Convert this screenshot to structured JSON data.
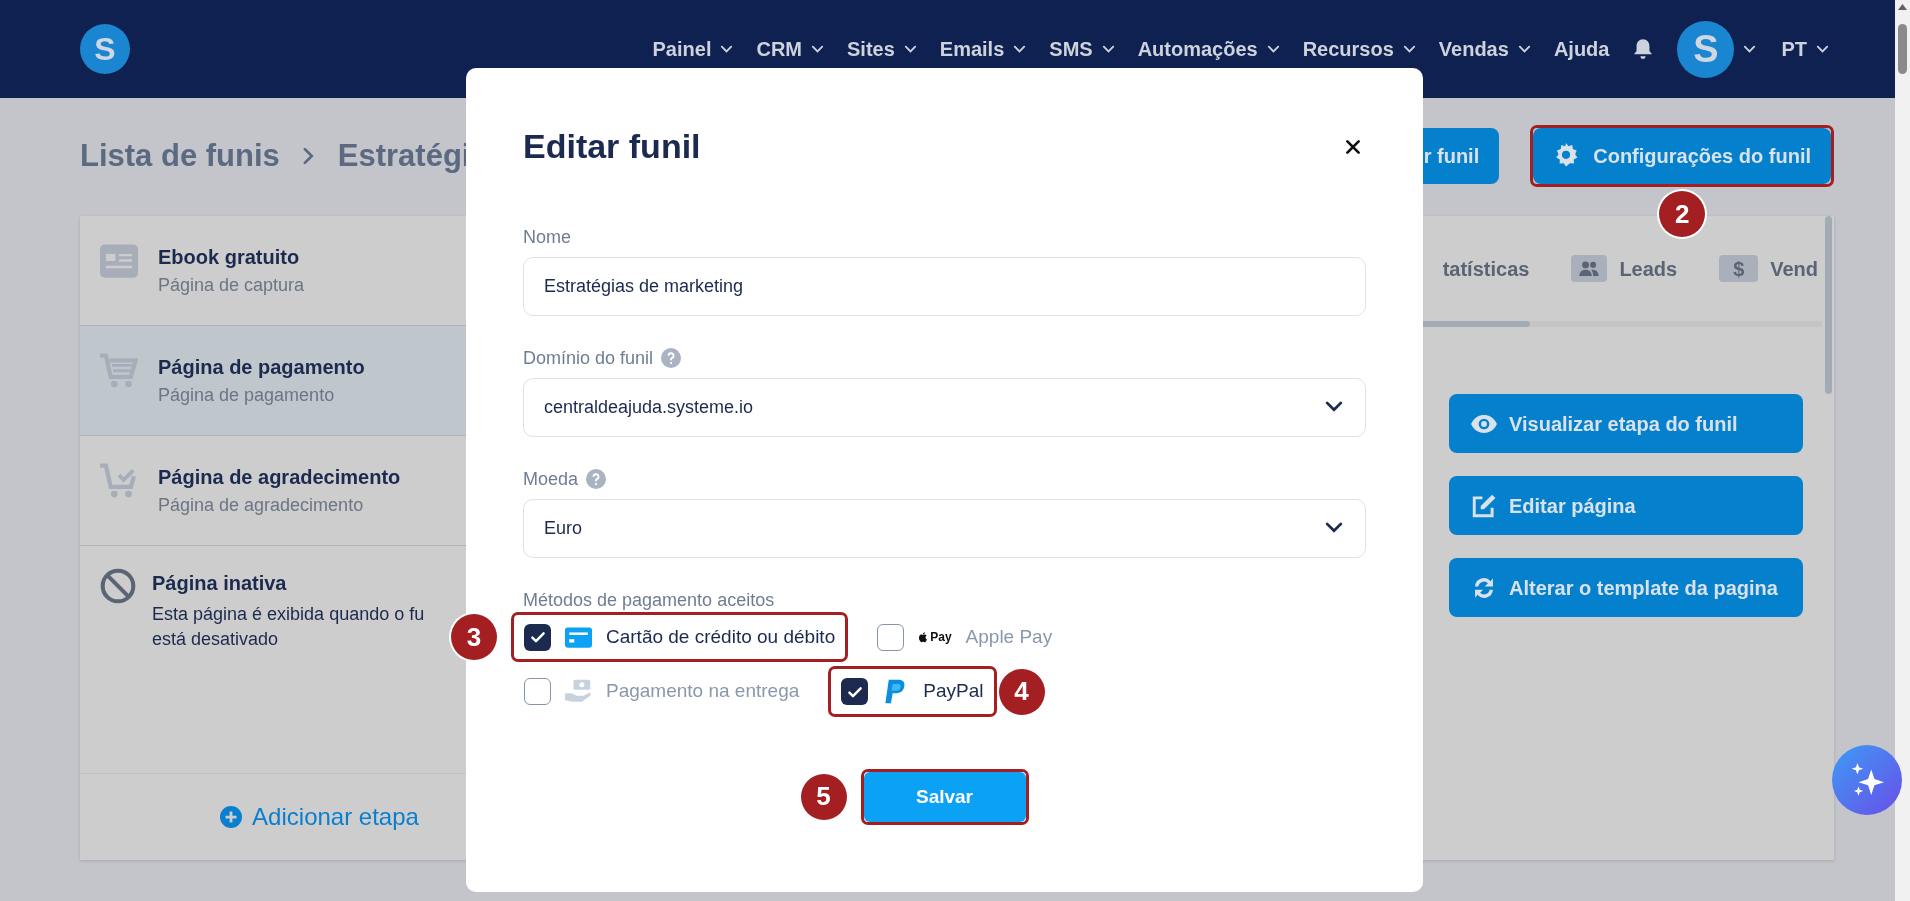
{
  "navbar": {
    "logo": "S",
    "menu": [
      {
        "label": "Painel",
        "dropdown": true
      },
      {
        "label": "CRM",
        "dropdown": true
      },
      {
        "label": "Sites",
        "dropdown": true
      },
      {
        "label": "Emails",
        "dropdown": true
      },
      {
        "label": "SMS",
        "dropdown": true
      },
      {
        "label": "Automações",
        "dropdown": true
      },
      {
        "label": "Recursos",
        "dropdown": true
      },
      {
        "label": "Vendas",
        "dropdown": true
      },
      {
        "label": "Ajuda",
        "dropdown": false
      }
    ],
    "avatar": "S",
    "language": "PT"
  },
  "breadcrumb": [
    "Lista de funis",
    "Estratégi"
  ],
  "header_buttons": [
    {
      "label": "r funil"
    },
    {
      "label": "Configurações do funil",
      "annotation": "2"
    }
  ],
  "steps": [
    {
      "title": "Ebook gratuito",
      "subtitle": "Página de captura",
      "kind": "capture",
      "selected": false
    },
    {
      "title": "Página de pagamento",
      "subtitle": "Página de pagamento",
      "kind": "cart",
      "selected": true
    },
    {
      "title": "Página de agradecimento",
      "subtitle": "Página de agradecimento",
      "kind": "cart-check",
      "selected": false
    }
  ],
  "inactive_step": {
    "title": "Página inativa",
    "description": "Esta página é exibida quando o fu\nestá desativado"
  },
  "add_step": "Adicionar etapa",
  "tabs": [
    {
      "label": "tatísticas"
    },
    {
      "label": "Leads"
    },
    {
      "label": "Vend",
      "icon_text": "$"
    }
  ],
  "actions": [
    {
      "label": "Visualizar etapa do funil"
    },
    {
      "label": "Editar página"
    },
    {
      "label": "Alterar o template da pagina"
    }
  ],
  "modal": {
    "title": "Editar funil",
    "fields": [
      {
        "label": "Nome",
        "kind": "text",
        "value": "Estratégias de marketing",
        "help": false
      },
      {
        "label": "Domínio do funil",
        "kind": "select",
        "value": "centraldeajuda.systeme.io",
        "help": true
      },
      {
        "label": "Moeda",
        "kind": "select",
        "value": "Euro",
        "help": true
      }
    ],
    "payment_label": "Métodos de pagamento aceitos",
    "payment_methods": [
      {
        "label": "Cartão de crédito ou débito",
        "checked": true,
        "annotation": "3"
      },
      {
        "label": "Apple Pay",
        "logo_text": "Pay",
        "checked": false
      },
      {
        "label": "Pagamento na entrega",
        "checked": false
      },
      {
        "label": "PayPal",
        "checked": true,
        "annotation": "4"
      }
    ],
    "save_button": {
      "label": "Salvar",
      "annotation": "5"
    }
  }
}
